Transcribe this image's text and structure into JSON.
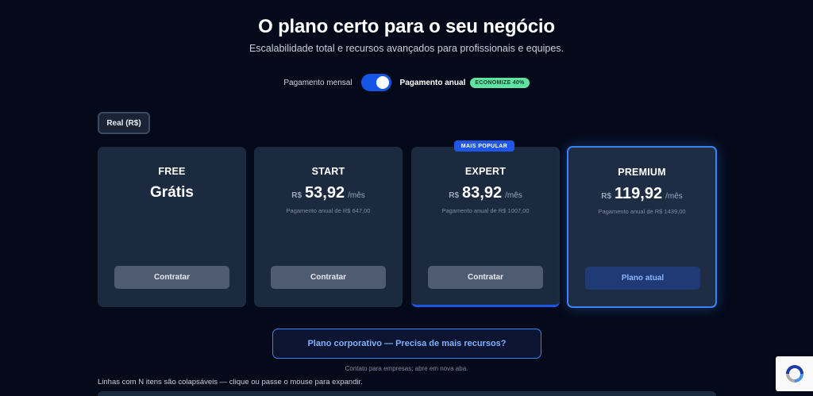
{
  "header": {
    "title": "O plano certo para o seu negócio",
    "subtitle": "Escalabilidade total e recursos avançados para profissionais e equipes."
  },
  "billing": {
    "monthly_label": "Pagamento mensal",
    "annual_label": "Pagamento anual",
    "save_badge": "ECONOMIZE 40%",
    "selected": "annual"
  },
  "currency_selector": {
    "label": "Real (R$)"
  },
  "plans": [
    {
      "name": "FREE",
      "price_text": "Grátis",
      "button": "Contratar"
    },
    {
      "name": "START",
      "currency": "R$",
      "price": "53,92",
      "period": "/mês",
      "annual_note": "Pagamento anual de R$ 647,00",
      "button": "Contratar"
    },
    {
      "name": "EXPERT",
      "badge": "MAIS POPULAR",
      "currency": "R$",
      "price": "83,92",
      "period": "/mês",
      "annual_note": "Pagamento anual de R$ 1007,00",
      "button": "Contratar"
    },
    {
      "name": "PREMIUM",
      "currency": "R$",
      "price": "119,92",
      "period": "/mês",
      "annual_note": "Pagamento anual de R$ 1439,00",
      "button": "Plano atual"
    }
  ],
  "corporate": {
    "button": "Plano corporativo — Precisa de mais recursos?",
    "note": "Contato para empresas; abre em nova aba."
  },
  "collapse_hint": "Linhas com N itens são colapsáveis — clique ou passe o mouse para expandir.",
  "colors": {
    "background": "#050a1a",
    "card": "#1c2a3f",
    "accent": "#1e56e8",
    "highlight_border": "#3b82f6",
    "badge_green": "#5fe3a3"
  },
  "icons": {
    "recaptcha": "recaptcha-icon"
  }
}
